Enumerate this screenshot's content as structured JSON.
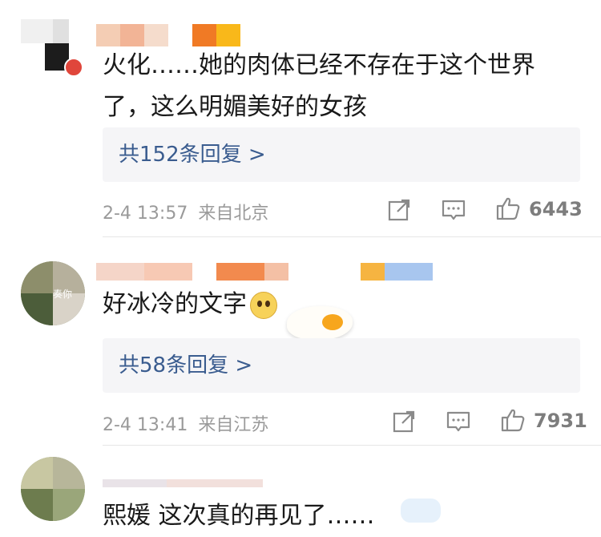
{
  "comments": [
    {
      "text_line1": "火化……她的肉体已经不存在于这个世界",
      "text_line2": "了，这么明媚美好的女孩",
      "replies_label": "共152条回复 >",
      "timestamp": "2-4 13:57",
      "source": "来自北京",
      "likes": "6443"
    },
    {
      "avatar_caption": "奏你",
      "text": "好冰冷的文字",
      "emoji": "pleading-face-icon",
      "replies_label": "共58条回复 >",
      "timestamp": "2-4 13:41",
      "source": "来自江苏",
      "likes": "7931"
    },
    {
      "text": "熙媛 这次真的再见了……"
    }
  ],
  "icons": {
    "share": "share-icon",
    "comment": "comment-icon",
    "like": "thumbs-up-icon"
  },
  "colors": {
    "reply_link": "#3a5c8f",
    "meta_gray": "#9a9a9a",
    "reply_bg": "#f5f5f7"
  }
}
